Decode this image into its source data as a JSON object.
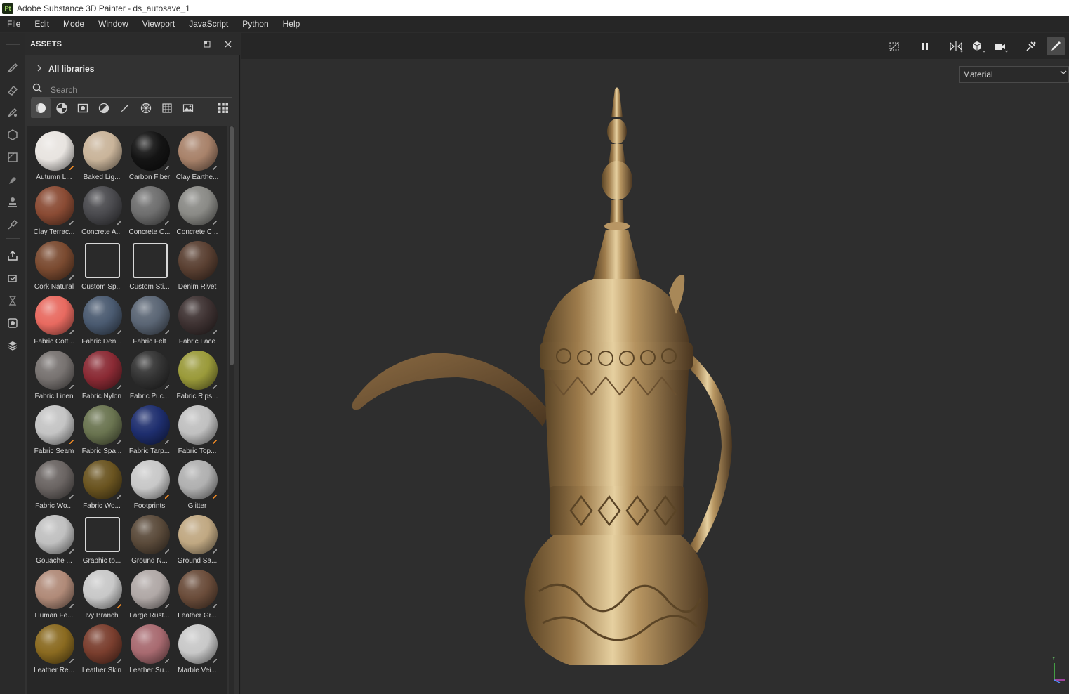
{
  "window": {
    "title": "Adobe Substance 3D Painter - ds_autosave_1",
    "app_badge": "Pt"
  },
  "menu": [
    "File",
    "Edit",
    "Mode",
    "Window",
    "Viewport",
    "JavaScript",
    "Python",
    "Help"
  ],
  "assets_panel": {
    "title": "ASSETS",
    "libraries_label": "All libraries",
    "search_placeholder": "Search",
    "items": [
      {
        "label": "Autumn L...",
        "color": "#e8e4e0",
        "badge": "orange"
      },
      {
        "label": "Baked Lig...",
        "color": "#c9b49a",
        "badge": "none"
      },
      {
        "label": "Carbon Fiber",
        "color": "#141414",
        "badge": "grey"
      },
      {
        "label": "Clay Earthe...",
        "color": "#a8826a",
        "badge": "grey"
      },
      {
        "label": "Clay Terrac...",
        "color": "#8a4b34",
        "badge": "grey"
      },
      {
        "label": "Concrete A...",
        "color": "#4a4a4e",
        "badge": "grey"
      },
      {
        "label": "Concrete C...",
        "color": "#6e6e6e",
        "badge": "grey"
      },
      {
        "label": "Concrete C...",
        "color": "#8a8a86",
        "badge": "grey"
      },
      {
        "label": "Cork Natural",
        "color": "#7a4a30",
        "badge": "grey"
      },
      {
        "label": "Custom Sp...",
        "color": "icon",
        "badge": "none"
      },
      {
        "label": "Custom Sti...",
        "color": "icon",
        "badge": "none"
      },
      {
        "label": "Denim Rivet",
        "color": "#5a4032",
        "badge": "none"
      },
      {
        "label": "Fabric Cott...",
        "color": "#e86a60",
        "badge": "grey"
      },
      {
        "label": "Fabric Den...",
        "color": "#4a5a70",
        "badge": "grey"
      },
      {
        "label": "Fabric Felt",
        "color": "#5a6574",
        "badge": "grey"
      },
      {
        "label": "Fabric Lace",
        "color": "#3e3232",
        "badge": "grey"
      },
      {
        "label": "Fabric Linen",
        "color": "#777270",
        "badge": "grey"
      },
      {
        "label": "Fabric Nylon",
        "color": "#8a2a34",
        "badge": "grey"
      },
      {
        "label": "Fabric Puc...",
        "color": "#333333",
        "badge": "grey"
      },
      {
        "label": "Fabric Rips...",
        "color": "#9a9a3a",
        "badge": "grey"
      },
      {
        "label": "Fabric Seam",
        "color": "#c4c4c4",
        "badge": "orange"
      },
      {
        "label": "Fabric Spa...",
        "color": "#6a7450",
        "badge": "grey"
      },
      {
        "label": "Fabric Tarp...",
        "color": "#1e2e6e",
        "badge": "grey"
      },
      {
        "label": "Fabric Top...",
        "color": "#c0c0c0",
        "badge": "orange"
      },
      {
        "label": "Fabric Wo...",
        "color": "#6a6462",
        "badge": "grey"
      },
      {
        "label": "Fabric Wo...",
        "color": "#6a5420",
        "badge": "grey"
      },
      {
        "label": "Footprints",
        "color": "#c8c8c8",
        "badge": "orange"
      },
      {
        "label": "Glitter",
        "color": "#b0b0b0",
        "badge": "orange"
      },
      {
        "label": "Gouache ...",
        "color": "#c0c0c0",
        "badge": "grey"
      },
      {
        "label": "Graphic to...",
        "color": "icon",
        "badge": "none"
      },
      {
        "label": "Ground N...",
        "color": "#5a4a3a",
        "badge": "grey"
      },
      {
        "label": "Ground Sa...",
        "color": "#c0a882",
        "badge": "grey"
      },
      {
        "label": "Human Fe...",
        "color": "#b08a78",
        "badge": "grey"
      },
      {
        "label": "Ivy Branch",
        "color": "#c8c8c8",
        "badge": "orange"
      },
      {
        "label": "Large Rust...",
        "color": "#b0a8a6",
        "badge": "grey"
      },
      {
        "label": "Leather Gr...",
        "color": "#6a4c3a",
        "badge": "grey"
      },
      {
        "label": "Leather Re...",
        "color": "#8a6a20",
        "badge": "grey"
      },
      {
        "label": "Leather Skin",
        "color": "#7a3e2e",
        "badge": "grey"
      },
      {
        "label": "Leather Su...",
        "color": "#a86a70",
        "badge": "grey"
      },
      {
        "label": "Marble Vei...",
        "color": "#c8c8c8",
        "badge": "grey"
      }
    ]
  },
  "viewport": {
    "channel_dropdown": "Material",
    "axis_label": "Y",
    "buttons": [
      "hide-ui",
      "pause",
      "symmetry",
      "projection",
      "camera",
      "baking",
      "paint"
    ]
  }
}
